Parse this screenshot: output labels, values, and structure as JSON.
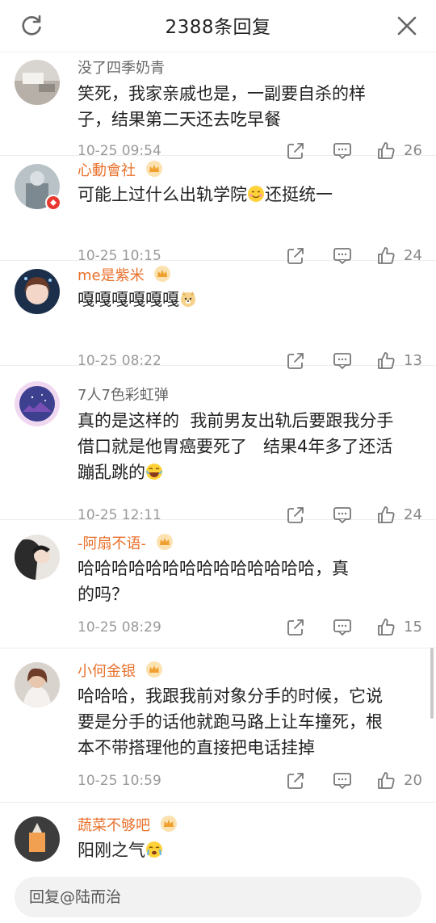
{
  "header": {
    "title": "2388条回复",
    "refresh_icon": "refresh-icon",
    "close_icon": "close-icon"
  },
  "comments": [
    {
      "username": "没了四季奶青",
      "name_color": "gray",
      "vip": false,
      "lines": [
        "笑死，我家亲戚也是，一副要自杀的样",
        "子，结果第二天还去吃早餐"
      ],
      "time": "10-25 09:54",
      "likes": "26"
    },
    {
      "username": "心動會社",
      "name_color": "orange",
      "vip": true,
      "lines": [
        "可能上过什么出轨学院",
        "还挺统一"
      ],
      "emoji_after_first": "smile",
      "time": "10-25 10:15",
      "likes": "24"
    },
    {
      "username": "me是紫米",
      "name_color": "orange",
      "vip": true,
      "lines": [
        "嘎嘎嘎嘎嘎嘎"
      ],
      "emoji_end": "dog",
      "time": "10-25 08:22",
      "likes": "13"
    },
    {
      "username": "7人7色彩虹弹",
      "name_color": "gray",
      "vip": false,
      "lines": [
        "真的是这样的  我前男友出轨后要跟我分手",
        "借口就是他胃癌要死了   结果4年多了还活",
        "蹦乱跳的"
      ],
      "emoji_end": "laugh",
      "time": "10-25 12:11",
      "likes": "24"
    },
    {
      "username": "-阿扇不语-",
      "name_color": "orange",
      "vip": true,
      "lines": [
        "哈哈哈哈哈哈哈哈哈哈哈哈哈哈，真",
        "的吗？"
      ],
      "time": "10-25 08:29",
      "likes": "15"
    },
    {
      "username": "小何金银",
      "name_color": "orange",
      "vip": true,
      "lines": [
        "哈哈哈，我跟我前对象分手的时候，它说",
        "要是分手的话他就跑马路上让车撞死，根",
        "本不带搭理他的直接把电话挂掉"
      ],
      "time": "10-25 10:59",
      "likes": "20"
    },
    {
      "username": "蔬菜不够吧",
      "name_color": "orange",
      "vip": true,
      "lines": [
        "阳刚之气"
      ],
      "emoji_end": "cry",
      "time": "",
      "likes": ""
    }
  ],
  "input": {
    "placeholder": "回复@陆而治"
  },
  "icons": {
    "share": "share-icon",
    "reply": "comment-icon",
    "like": "thumbs-up-icon",
    "vip": "crown-icon"
  },
  "colors": {
    "orange_name": "#e8712c",
    "gray_name": "#666666",
    "vip_badge": "#f0a030"
  }
}
